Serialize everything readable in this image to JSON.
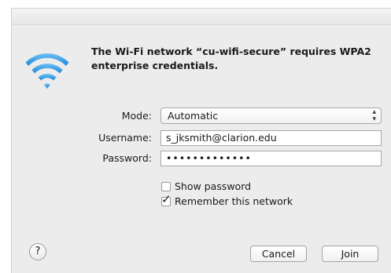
{
  "dialog": {
    "message": "The Wi-Fi network “cu-wifi-secure” requires WPA2 enterprise credentials.",
    "icon": "wifi-icon"
  },
  "form": {
    "mode_label": "Mode:",
    "mode_value": "Automatic",
    "username_label": "Username:",
    "username_value": "s_jksmith@clarion.edu",
    "password_label": "Password:",
    "password_value": "•••••••••••••",
    "show_password_label": "Show password",
    "show_password_checked": false,
    "remember_label": "Remember this network",
    "remember_checked": true
  },
  "buttons": {
    "help": "?",
    "cancel": "Cancel",
    "join": "Join"
  },
  "colors": {
    "wifi_accent": "#3a9be6",
    "dialog_bg": "#ececec"
  }
}
